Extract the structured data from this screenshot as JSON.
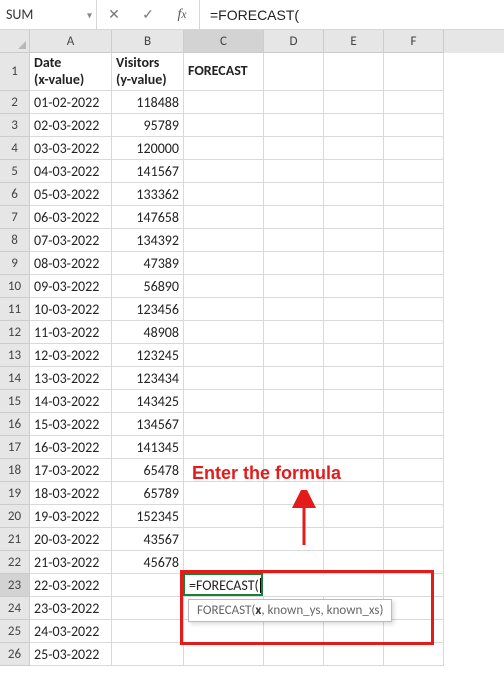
{
  "name_box": "SUM",
  "formula_bar": "=FORECAST(",
  "columns": [
    "A",
    "B",
    "C",
    "D",
    "E",
    "F"
  ],
  "headers": {
    "A": "Date\n(x-value)",
    "B": "Visitors\n(y-value)",
    "C": "FORECAST"
  },
  "rows": [
    {
      "n": 2,
      "A": "01-02-2022",
      "B": "118488"
    },
    {
      "n": 3,
      "A": "02-03-2022",
      "B": "95789"
    },
    {
      "n": 4,
      "A": "03-03-2022",
      "B": "120000"
    },
    {
      "n": 5,
      "A": "04-03-2022",
      "B": "141567"
    },
    {
      "n": 6,
      "A": "05-03-2022",
      "B": "133362"
    },
    {
      "n": 7,
      "A": "06-03-2022",
      "B": "147658"
    },
    {
      "n": 8,
      "A": "07-03-2022",
      "B": "134392"
    },
    {
      "n": 9,
      "A": "08-03-2022",
      "B": "47389"
    },
    {
      "n": 10,
      "A": "09-03-2022",
      "B": "56890"
    },
    {
      "n": 11,
      "A": "10-03-2022",
      "B": "123456"
    },
    {
      "n": 12,
      "A": "11-03-2022",
      "B": "48908"
    },
    {
      "n": 13,
      "A": "12-03-2022",
      "B": "123245"
    },
    {
      "n": 14,
      "A": "13-03-2022",
      "B": "123434"
    },
    {
      "n": 15,
      "A": "14-03-2022",
      "B": "143425"
    },
    {
      "n": 16,
      "A": "15-03-2022",
      "B": "134567"
    },
    {
      "n": 17,
      "A": "16-03-2022",
      "B": "141345"
    },
    {
      "n": 18,
      "A": "17-03-2022",
      "B": "65478"
    },
    {
      "n": 19,
      "A": "18-03-2022",
      "B": "65789"
    },
    {
      "n": 20,
      "A": "19-03-2022",
      "B": "152345"
    },
    {
      "n": 21,
      "A": "20-03-2022",
      "B": "43567"
    },
    {
      "n": 22,
      "A": "21-03-2022",
      "B": "45678"
    },
    {
      "n": 23,
      "A": "22-03-2022",
      "B": ""
    },
    {
      "n": 24,
      "A": "23-03-2022",
      "B": ""
    },
    {
      "n": 25,
      "A": "24-03-2022",
      "B": ""
    },
    {
      "n": 26,
      "A": "25-03-2022",
      "B": ""
    }
  ],
  "active_cell_text": "=FORECAST(",
  "tooltip": {
    "fn": "FORECAST(",
    "arg1": "x",
    "rest": ", known_ys, known_xs)"
  },
  "annotation_text": "Enter the formula"
}
